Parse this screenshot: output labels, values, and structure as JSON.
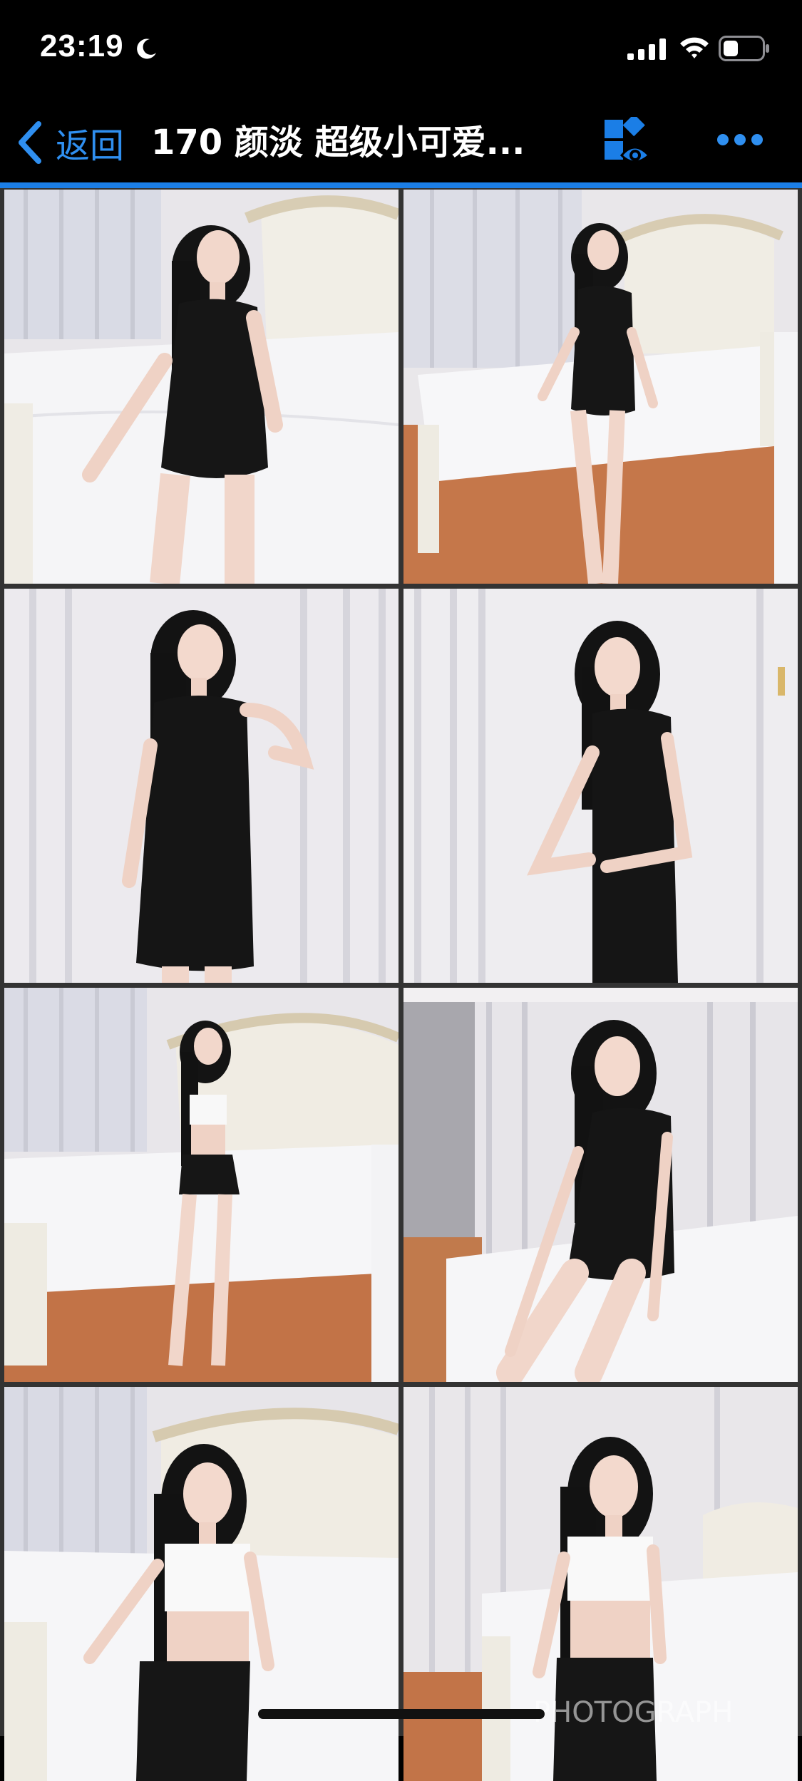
{
  "status_bar": {
    "time": "23:19",
    "icons": [
      "moon-icon",
      "signal-icon",
      "wifi-icon",
      "battery-icon"
    ]
  },
  "nav": {
    "back_label": "返回",
    "title": "170 颜淡 超级小可爱...",
    "accent_color": "#1b7ee6",
    "actions": [
      "grid-eye-icon",
      "more-icon"
    ]
  },
  "gallery": {
    "photos": [
      {
        "id": "photo-1",
        "scene": "bedroom",
        "outfit": "black-dress"
      },
      {
        "id": "photo-2",
        "scene": "bedroom",
        "outfit": "black-dress"
      },
      {
        "id": "photo-3",
        "scene": "curtain",
        "outfit": "black-dress"
      },
      {
        "id": "photo-4",
        "scene": "curtain",
        "outfit": "black-dress"
      },
      {
        "id": "photo-5",
        "scene": "bedroom",
        "outfit": "white-top"
      },
      {
        "id": "photo-6",
        "scene": "bedroom",
        "outfit": "black-dress"
      },
      {
        "id": "photo-7",
        "scene": "bedroom",
        "outfit": "white-top"
      },
      {
        "id": "photo-8",
        "scene": "bedroom",
        "outfit": "white-top"
      }
    ]
  },
  "watermark": "PHOTOGRAPH"
}
